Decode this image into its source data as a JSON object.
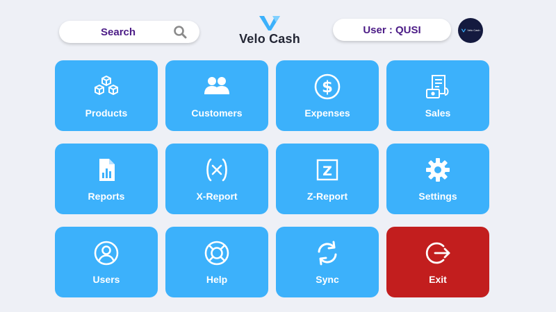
{
  "header": {
    "search_placeholder": "Search",
    "search_icon": "search-icon",
    "brand_name": "Velo Cash",
    "user_label": "User : QUSI",
    "avatar_text": "Velo Cash"
  },
  "colors": {
    "background": "#eef0f6",
    "tile": "#3cb1fb",
    "tile_exit": "#c21e1e",
    "accent_text": "#4b1b86",
    "avatar_bg": "#141a3f"
  },
  "tiles": [
    {
      "label": "Products",
      "icon": "boxes-icon"
    },
    {
      "label": "Customers",
      "icon": "users-group-icon"
    },
    {
      "label": "Expenses",
      "icon": "dollar-circle-icon"
    },
    {
      "label": "Sales",
      "icon": "receipt-money-icon"
    },
    {
      "label": "Reports",
      "icon": "report-file-icon"
    },
    {
      "label": "X-Report",
      "icon": "x-report-icon"
    },
    {
      "label": "Z-Report",
      "icon": "z-report-icon"
    },
    {
      "label": "Settings",
      "icon": "gear-icon"
    },
    {
      "label": "Users",
      "icon": "user-circle-icon"
    },
    {
      "label": "Help",
      "icon": "lifebuoy-icon"
    },
    {
      "label": "Sync",
      "icon": "sync-icon"
    },
    {
      "label": "Exit",
      "icon": "exit-icon"
    }
  ]
}
